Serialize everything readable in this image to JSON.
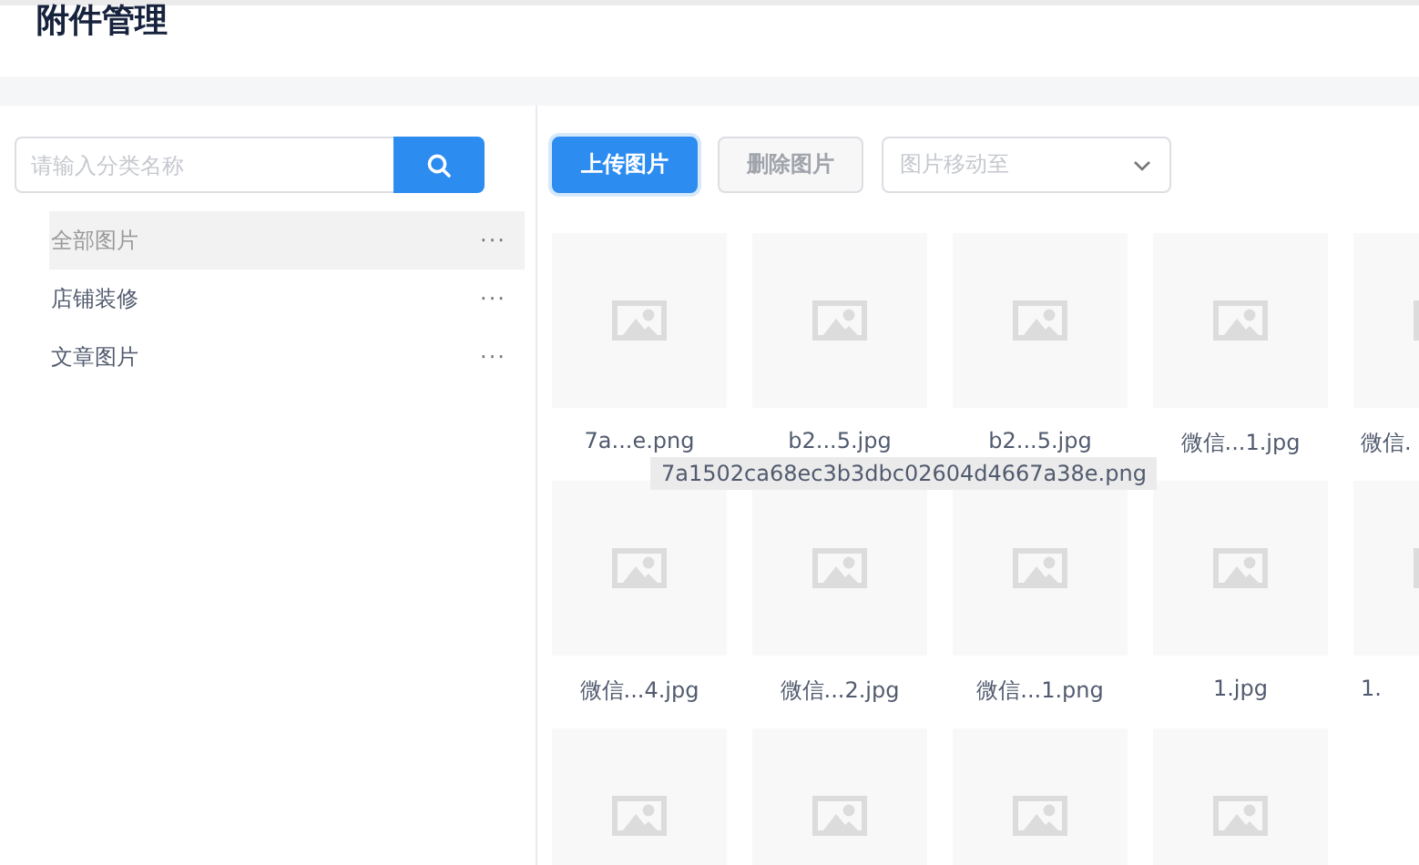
{
  "page": {
    "title": "附件管理"
  },
  "sidebar": {
    "search": {
      "placeholder": "请输入分类名称"
    },
    "categories": [
      {
        "label": "全部图片",
        "selected": true,
        "more": "···"
      },
      {
        "label": "店铺装修",
        "selected": false,
        "more": "···"
      },
      {
        "label": "文章图片",
        "selected": false,
        "more": "···"
      }
    ]
  },
  "toolbar": {
    "upload": {
      "label": "上传图片",
      "disabled": false
    },
    "delete": {
      "label": "删除图片",
      "disabled": true
    },
    "move": {
      "placeholder": "图片移动至"
    }
  },
  "images": [
    {
      "kind": "picture",
      "label": "7a...e.png"
    },
    {
      "kind": "picture",
      "label": "b2...5.jpg"
    },
    {
      "kind": "picture",
      "label": "b2...5.jpg"
    },
    {
      "kind": "picture",
      "label": "微信...1.jpg"
    },
    {
      "kind": "picture",
      "label": "微信."
    },
    {
      "kind": "picture",
      "label": "微信...4.jpg"
    },
    {
      "kind": "picture",
      "label": "微信...2.jpg"
    },
    {
      "kind": "picture",
      "label": "微信...1.png"
    },
    {
      "kind": "picture",
      "label": "1.jpg"
    },
    {
      "kind": "picture",
      "label": "1."
    },
    {
      "kind": "picture"
    },
    {
      "kind": "picture"
    },
    {
      "kind": "picture"
    },
    {
      "kind": "picture"
    }
  ],
  "tooltip": {
    "text": "7a1502ca68ec3b3dbc02604d4667a38e.png"
  }
}
